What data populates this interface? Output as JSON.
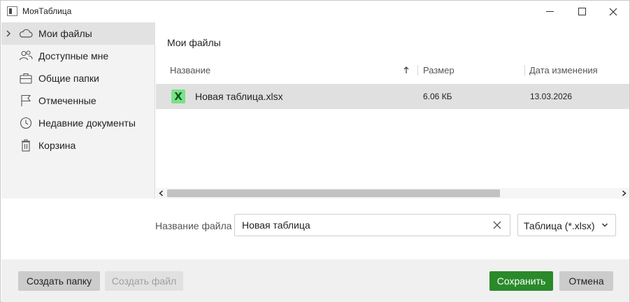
{
  "window": {
    "title": "МояТаблица",
    "icons": [
      "app-icon",
      "minimize-icon",
      "maximize-icon",
      "close-icon"
    ]
  },
  "sidebar": {
    "items": [
      {
        "label": "Мои файлы",
        "icon": "cloud-icon",
        "active": true,
        "expandable": true
      },
      {
        "label": "Доступные мне",
        "icon": "users-icon",
        "active": false
      },
      {
        "label": "Общие папки",
        "icon": "briefcase-icon",
        "active": false
      },
      {
        "label": "Отмеченные",
        "icon": "flag-icon",
        "active": false
      },
      {
        "label": "Недавние документы",
        "icon": "clock-icon",
        "active": false
      },
      {
        "label": "Корзина",
        "icon": "trash-icon",
        "active": false
      }
    ]
  },
  "main": {
    "folder_title": "Мои файлы",
    "columns": {
      "name": "Название",
      "size": "Размер",
      "modified": "Дата изменения"
    },
    "sort": {
      "column": "name",
      "direction": "ascending"
    },
    "rows": [
      {
        "icon": "xlsx-file-icon",
        "icon_letter": "X",
        "name": "Новая таблица.xlsx",
        "size": "6.06 КБ",
        "modified": "13.03.2026",
        "selected": true
      }
    ]
  },
  "save_form": {
    "filename_label": "Название файла",
    "filename_value": "Новая таблица",
    "file_type": "Таблица (*.xlsx)"
  },
  "footer": {
    "create_folder": "Создать папку",
    "create_file": "Создать файл",
    "save": "Сохранить",
    "cancel": "Отмена"
  },
  "colors": {
    "accent": "#2a8a2a",
    "selection": "#e0e0e0",
    "sidebar_bg": "#f3f3f3",
    "xlsx_icon": "#7be08a"
  }
}
